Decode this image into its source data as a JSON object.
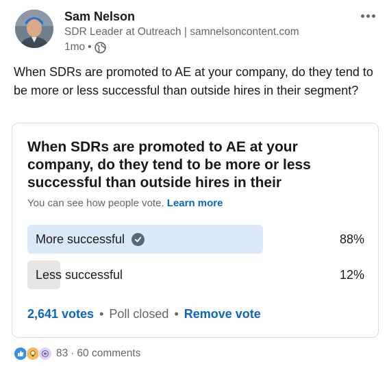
{
  "author": {
    "name": "Sam Nelson",
    "headline": "SDR Leader at Outreach | samnelsoncontent.com",
    "time": "1mo",
    "separator": "•"
  },
  "commentary": "When SDRs are promoted to AE at your company, do they tend to be more or less successful than outside hires in their segment?",
  "poll": {
    "question": "When SDRs are promoted to AE at your company, do they tend to be more or less successful than outside hires in their",
    "note": "You can see how people vote.",
    "learn_more": "Learn more",
    "options": [
      {
        "label": "More successful",
        "percent": "88%",
        "fraction": 0.88,
        "selected": true,
        "bar_color": "#dce9f9"
      },
      {
        "label": "Less successful",
        "percent": "12%",
        "fraction": 0.12,
        "selected": false,
        "bar_color": "#e6e6e6"
      }
    ],
    "votes": "2,641 votes",
    "status": "Poll closed",
    "remove_vote": "Remove vote",
    "dot": "•"
  },
  "social": {
    "reaction_icons": [
      "like-icon",
      "insightful-icon",
      "curious-icon"
    ],
    "reaction_count": "83",
    "dot": "·",
    "comments": "60 comments"
  },
  "colors": {
    "link": "#0a66c2",
    "muted": "#666666",
    "text": "#191919"
  }
}
